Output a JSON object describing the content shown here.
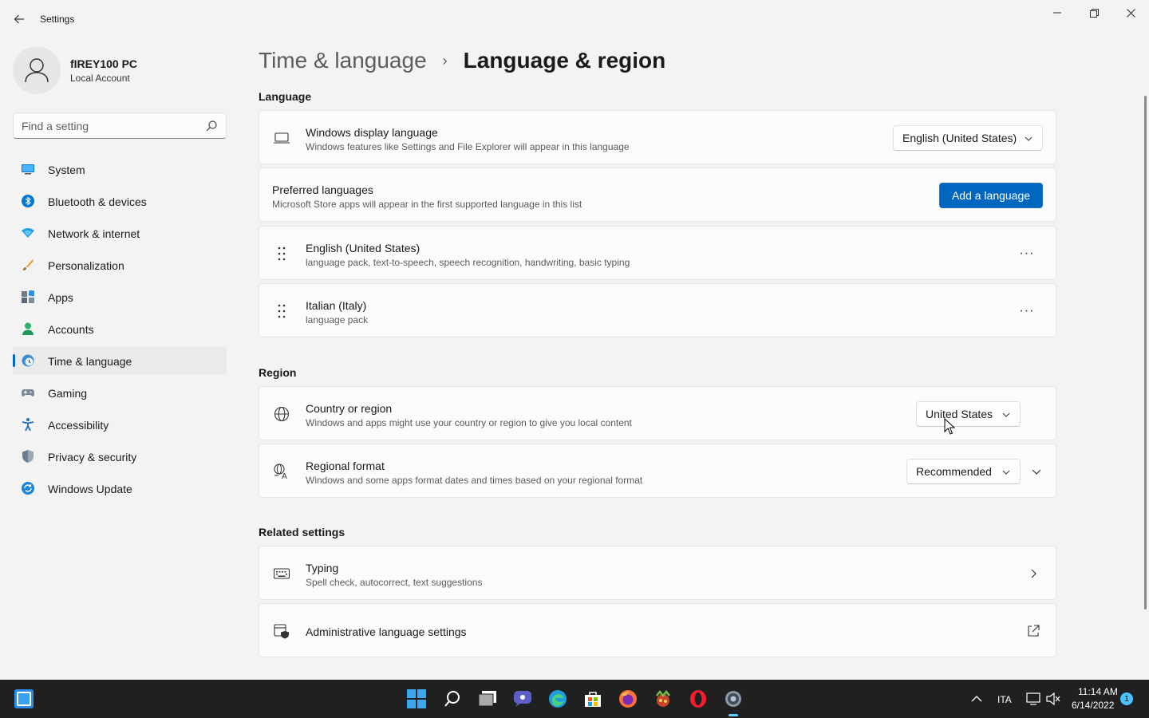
{
  "window": {
    "app_title": "Settings",
    "controls": {
      "minimize": "─",
      "maximize": "❐",
      "close": "✕"
    }
  },
  "profile": {
    "name": "fIREY100 PC",
    "account_type": "Local Account"
  },
  "search": {
    "placeholder": "Find a setting",
    "value": ""
  },
  "sidebar": {
    "items": [
      {
        "label": "System",
        "icon": "system-icon",
        "active": false
      },
      {
        "label": "Bluetooth & devices",
        "icon": "bluetooth-icon",
        "active": false
      },
      {
        "label": "Network & internet",
        "icon": "wifi-icon",
        "active": false
      },
      {
        "label": "Personalization",
        "icon": "brush-icon",
        "active": false
      },
      {
        "label": "Apps",
        "icon": "apps-icon",
        "active": false
      },
      {
        "label": "Accounts",
        "icon": "person-icon",
        "active": false
      },
      {
        "label": "Time & language",
        "icon": "clock-globe-icon",
        "active": true
      },
      {
        "label": "Gaming",
        "icon": "controller-icon",
        "active": false
      },
      {
        "label": "Accessibility",
        "icon": "accessibility-icon",
        "active": false
      },
      {
        "label": "Privacy & security",
        "icon": "shield-icon",
        "active": false
      },
      {
        "label": "Windows Update",
        "icon": "update-icon",
        "active": false
      }
    ]
  },
  "breadcrumb": {
    "parent": "Time & language",
    "separator": "›",
    "current": "Language & region"
  },
  "language_section": {
    "title": "Language",
    "display_language": {
      "title": "Windows display language",
      "description": "Windows features like Settings and File Explorer will appear in this language",
      "value": "English (United States)"
    },
    "preferred": {
      "title": "Preferred languages",
      "description": "Microsoft Store apps will appear in the first supported language in this list",
      "button": "Add a language"
    },
    "languages": [
      {
        "name": "English (United States)",
        "features": "language pack, text-to-speech, speech recognition, handwriting, basic typing",
        "more": "···"
      },
      {
        "name": "Italian (Italy)",
        "features": "language pack",
        "more": "···"
      }
    ]
  },
  "region_section": {
    "title": "Region",
    "country": {
      "title": "Country or region",
      "description": "Windows and apps might use your country or region to give you local content",
      "value": "United States"
    },
    "format": {
      "title": "Regional format",
      "description": "Windows and some apps format dates and times based on your regional format",
      "value": "Recommended"
    }
  },
  "related_section": {
    "title": "Related settings",
    "typing": {
      "title": "Typing",
      "description": "Spell check, autocorrect, text suggestions"
    },
    "admin": {
      "title": "Administrative language settings"
    }
  },
  "taskbar": {
    "language": "ITA",
    "time": "11:14 AM",
    "date": "6/14/2022",
    "notification_count": "1",
    "colors": {
      "accent": "#0067c0",
      "taskbar_bg": "#202020"
    }
  }
}
